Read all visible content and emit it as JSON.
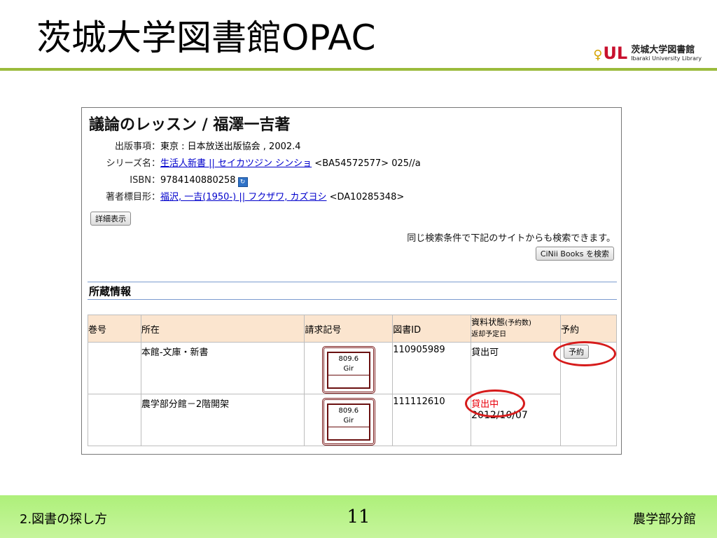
{
  "slide": {
    "title": "茨城大学図書館OPAC",
    "logo": {
      "mark_p": "♀",
      "mark_u": "U",
      "mark_l": "L",
      "name_jp": "茨城大学図書館",
      "name_en": "Ibaraki University Library"
    },
    "footer": {
      "left": "2.図書の探し方",
      "page_number": "11",
      "right": "農学部分館"
    }
  },
  "record": {
    "title": "議論のレッスン / 福澤一吉著",
    "fields": [
      {
        "label": "出版事項：",
        "value": "東京 : 日本放送出版協会 , 2002.4"
      },
      {
        "label": "シリーズ名：",
        "link": "生活人新書 || セイカツジン シンショ",
        "suffix": " <BA54572577> 025//a"
      },
      {
        "label": "ISBN：",
        "value": "9784140880258"
      },
      {
        "label": "著者標目形：",
        "link": "福沢, 一吉(1950-) || フクザワ, カズヨシ",
        "suffix": " <DA10285348>"
      }
    ],
    "detail_button": "詳細表示",
    "search_note": "同じ検索条件で下記のサイトからも検索できます。",
    "cinii_button": "CiNii Books を検索",
    "holdings_title": "所蔵情報",
    "columns": {
      "volume": "巻号",
      "location": "所在",
      "call_number": "請求記号",
      "book_id": "図書ID",
      "status_main": "資料状態",
      "status_count": "(予約数)",
      "status_due": "返却予定日",
      "reserve": "予約"
    },
    "rows": [
      {
        "volume": "",
        "location": "本館-文庫・新書",
        "call_class": "809.6",
        "call_author": "Gir",
        "book_id": "110905989",
        "status": "貸出可",
        "due": "",
        "reserve_button": "予約"
      },
      {
        "volume": "",
        "location": "農学部分館－2階開架",
        "call_class": "809.6",
        "call_author": "Gir",
        "book_id": "111112610",
        "status": "貸出中",
        "due": "2012/10/07"
      }
    ]
  },
  "colors": {
    "title_rule": "#9bbb3c",
    "table_header": "#fbe5cf",
    "annotation": "#d61b1b",
    "link": "#0000cc",
    "footer": "#b8f28a"
  }
}
